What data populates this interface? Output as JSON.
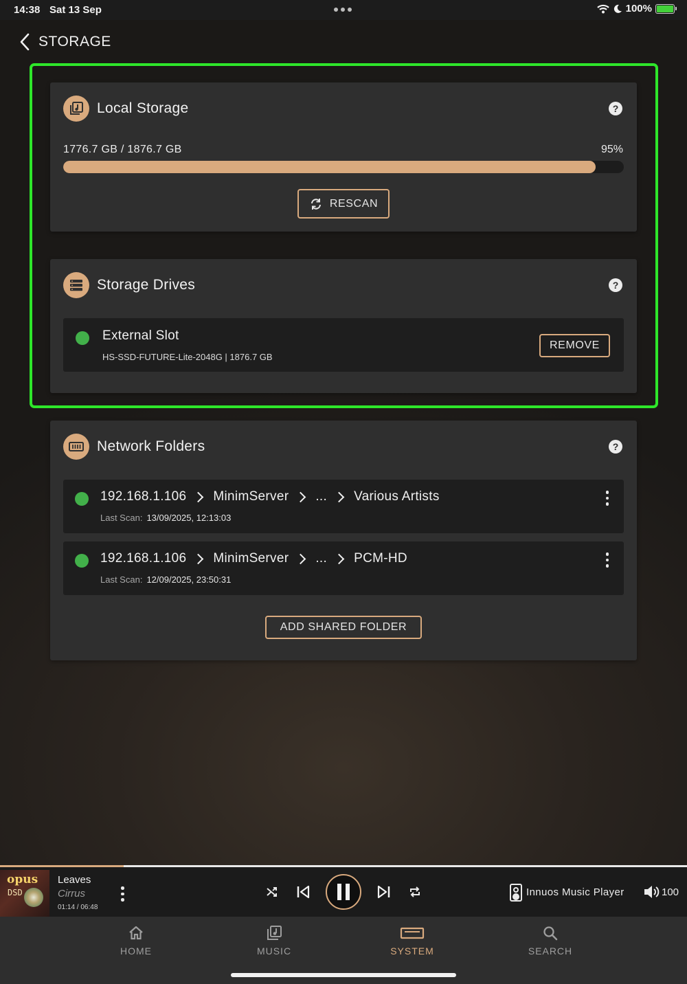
{
  "status_bar": {
    "time": "14:38",
    "date": "Sat 13 Sep",
    "battery": "100%"
  },
  "header": {
    "title": "STORAGE"
  },
  "local_storage": {
    "title": "Local Storage",
    "usage_text": "1776.7 GB / 1876.7 GB",
    "usage_percent_label": "95%",
    "usage_fraction": 0.95,
    "rescan_label": "RESCAN"
  },
  "storage_drives": {
    "title": "Storage Drives",
    "drives": [
      {
        "name": "External Slot",
        "details": "HS-SSD-FUTURE-Lite-2048G | 1876.7 GB",
        "remove_label": "REMOVE"
      }
    ]
  },
  "network_folders": {
    "title": "Network Folders",
    "last_scan_label": "Last Scan:",
    "folders": [
      {
        "host": "192.168.1.106",
        "server": "MinimServer",
        "ellipsis": "...",
        "folder": "Various Artists",
        "last_scan": "13/09/2025, 12:13:03"
      },
      {
        "host": "192.168.1.106",
        "server": "MinimServer",
        "ellipsis": "...",
        "folder": "PCM-HD",
        "last_scan": "12/09/2025, 23:50:31"
      }
    ],
    "add_label": "ADD SHARED FOLDER"
  },
  "now_playing": {
    "title": "Leaves",
    "artist": "Cirrus",
    "time": "01:14 / 06:48",
    "progress_fraction": 0.18,
    "album_art": {
      "brand": "opus",
      "format": "DSD"
    },
    "player_name": "Innuos Music Player",
    "volume": "100"
  },
  "tabs": [
    {
      "label": "HOME",
      "icon": "home-icon",
      "active": false
    },
    {
      "label": "MUSIC",
      "icon": "music-library-icon",
      "active": false
    },
    {
      "label": "SYSTEM",
      "icon": "system-icon",
      "active": true
    },
    {
      "label": "SEARCH",
      "icon": "search-icon",
      "active": false
    }
  ],
  "colors": {
    "accent": "#d9aa7e",
    "status_ok": "#42b04a",
    "highlight": "#2ee62a",
    "card": "#2f2f2f",
    "row": "#1e1e1e"
  }
}
